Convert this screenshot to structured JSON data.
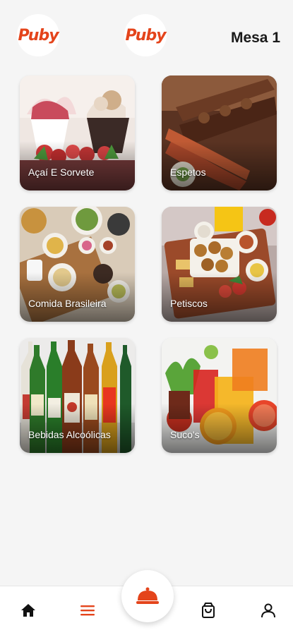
{
  "header": {
    "logo_left": "Puby",
    "logo_center": "Puby",
    "table_label": "Mesa 1"
  },
  "categories": [
    {
      "label": "Açaí E Sorvete"
    },
    {
      "label": "Espetos"
    },
    {
      "label": "Comida Brasileira"
    },
    {
      "label": "Petiscos"
    },
    {
      "label": "Bebidas Alcoólicas"
    },
    {
      "label": "Suco's"
    }
  ],
  "bottom_nav": {
    "items": [
      "home-icon",
      "menu-icon",
      "cloche-icon",
      "shopping-bag-icon",
      "user-icon"
    ],
    "accent_color": "#e4441b",
    "active": "menu-icon"
  },
  "colors": {
    "brand": "#e4441b",
    "background": "#f5f5f5"
  }
}
